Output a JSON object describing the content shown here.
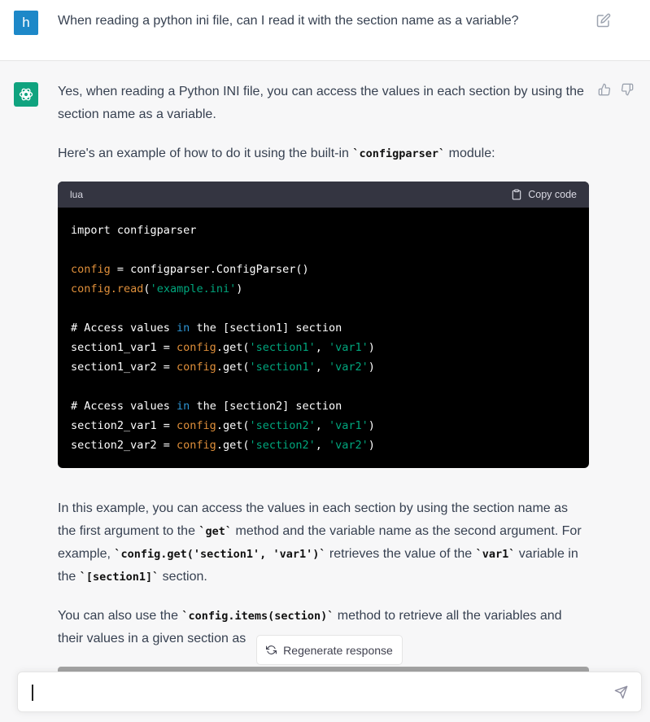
{
  "user": {
    "avatar_letter": "h",
    "message": "When reading a python ini file, can I read it with the section name as a variable?"
  },
  "assistant": {
    "para1": "Yes, when reading a Python INI file, you can access the values in each section by using the section name as a variable.",
    "para2_pre": "Here's an example of how to do it using the built-in ",
    "para2_code": "`configparser`",
    "para2_post": " module:",
    "code": {
      "language": "lua",
      "copy_label": "Copy code",
      "lines": {
        "l1": "import configparser",
        "l3a": "config",
        "l3b": " = configparser.ConfigParser()",
        "l4a": "config",
        "l4b": ".read",
        "l4c": "(",
        "l4d": "'example.ini'",
        "l4e": ")",
        "l6a": "# Access values ",
        "l6b": "in",
        "l6c": " the [section1] section",
        "l7a": "section1_var1 = ",
        "l7b": "config",
        "l7c": ".get(",
        "l7d": "'section1'",
        "l7e": ", ",
        "l7f": "'var1'",
        "l7g": ")",
        "l8a": "section1_var2 = ",
        "l8b": "config",
        "l8c": ".get(",
        "l8d": "'section1'",
        "l8e": ", ",
        "l8f": "'var2'",
        "l8g": ")",
        "l10a": "# Access values ",
        "l10b": "in",
        "l10c": " the [section2] section",
        "l11a": "section2_var1 = ",
        "l11b": "config",
        "l11c": ".get(",
        "l11d": "'section2'",
        "l11e": ", ",
        "l11f": "'var1'",
        "l11g": ")",
        "l12a": "section2_var2 = ",
        "l12b": "config",
        "l12c": ".get(",
        "l12d": "'section2'",
        "l12e": ", ",
        "l12f": "'var2'",
        "l12g": ")"
      }
    },
    "para3": {
      "t1": "In this example, you can access the values in each section by using the section name as the first argument to the ",
      "c1": "`get`",
      "t2": " method and the variable name as the second argument. For example, ",
      "c2": "`config.get('section1', 'var1')`",
      "t3": " retrieves the value of the ",
      "c3": "`var1`",
      "t4": " variable in the ",
      "c4": "`[section1]`",
      "t5": " section."
    },
    "para4": {
      "t1": "You can also use the ",
      "c1": "`config.items(section)`",
      "t2": " method to retrieve all the variables and their values in a given section as"
    }
  },
  "regenerate_label": "Regenerate response",
  "input": {
    "value": "",
    "placeholder": ""
  },
  "colors": {
    "user_avatar": "#1d88c8",
    "assistant_avatar": "#10a37f"
  },
  "icons": {
    "edit": "pencil-square-icon",
    "thumbs_up": "thumbs-up-icon",
    "thumbs_down": "thumbs-down-icon",
    "copy": "clipboard-icon",
    "regenerate": "refresh-icon",
    "send": "paper-plane-icon"
  }
}
